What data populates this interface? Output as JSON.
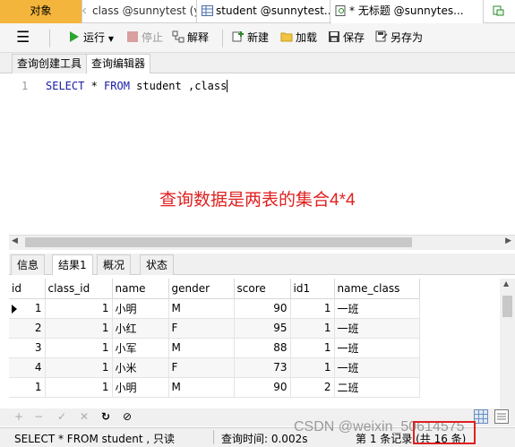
{
  "tabs": [
    {
      "label": "对象",
      "active": true
    },
    {
      "label": "class @sunnytest (y...",
      "icon": "table-icon"
    },
    {
      "label": "student @sunnytest...",
      "icon": "table-icon"
    },
    {
      "label": "* 无标题 @sunnytes...",
      "icon": "query-icon"
    }
  ],
  "toolbar": {
    "run": "运行",
    "stop": "停止",
    "explain": "解释",
    "new": "新建",
    "load": "加载",
    "save": "保存",
    "save_as": "另存为"
  },
  "subtabs": [
    "查询创建工具",
    "查询编辑器"
  ],
  "editor": {
    "line_number": "1",
    "kw_select": "SELECT",
    "star": " * ",
    "kw_from": "FROM",
    "rest": " student ,class"
  },
  "annotation": "查询数据是两表的集合4*4",
  "result_tabs": [
    "信息",
    "结果1",
    "概况",
    "状态"
  ],
  "grid": {
    "columns": [
      "id",
      "class_id",
      "name",
      "gender",
      "score",
      "id1",
      "name_class"
    ],
    "rows": [
      [
        "1",
        "1",
        "小明",
        "M",
        "90",
        "1",
        "一班"
      ],
      [
        "2",
        "1",
        "小红",
        "F",
        "95",
        "1",
        "一班"
      ],
      [
        "3",
        "1",
        "小军",
        "M",
        "88",
        "1",
        "一班"
      ],
      [
        "4",
        "1",
        "小米",
        "F",
        "73",
        "1",
        "一班"
      ],
      [
        "1",
        "1",
        "小明",
        "M",
        "90",
        "2",
        "二班"
      ]
    ]
  },
  "status": {
    "sql": "SELECT * FROM student , 只读",
    "query_time": "查询时间: 0.002s",
    "record": "第 1 条记录 (共 16 条)"
  },
  "watermark": "CSDN @weixin_50614575",
  "colors": {
    "accent_red": "#e02020",
    "keyword_blue": "#1a1aa6"
  }
}
